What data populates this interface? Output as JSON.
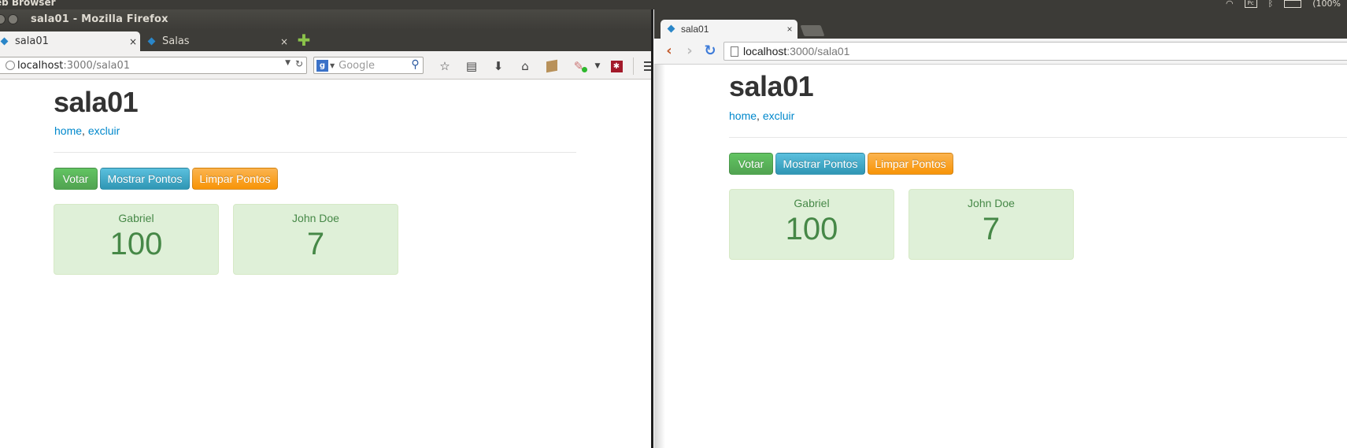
{
  "system_panel": {
    "label": "eb Browser",
    "battery": "(100%"
  },
  "firefox": {
    "window_title": "sala01 - Mozilla Firefox",
    "tabs": [
      {
        "label": "sala01",
        "close": "×"
      },
      {
        "label": "Salas",
        "close": "×"
      }
    ],
    "url": {
      "host": "localhost",
      "path": ":3000/sala01"
    },
    "search": {
      "engine": "g",
      "placeholder": "Google"
    }
  },
  "chromium": {
    "tabs": [
      {
        "label": "sala01",
        "close": "×"
      }
    ],
    "url": {
      "host": "localhost",
      "path": ":3000/sala01"
    }
  },
  "page": {
    "title": "sala01",
    "links": {
      "home": "home",
      "separator": ", ",
      "delete": "excluir"
    },
    "buttons": {
      "vote": "Votar",
      "show_points": "Mostrar Pontos",
      "clear_points": "Limpar Pontos"
    },
    "players": [
      {
        "name": "Gabriel",
        "points": "100"
      },
      {
        "name": "John Doe",
        "points": "7"
      }
    ]
  },
  "colors": {
    "success": "#5bb75b",
    "info": "#49afcd",
    "warning": "#faa732",
    "card_bg": "#dff0d8",
    "card_text": "#468847",
    "link": "#0088cc"
  }
}
